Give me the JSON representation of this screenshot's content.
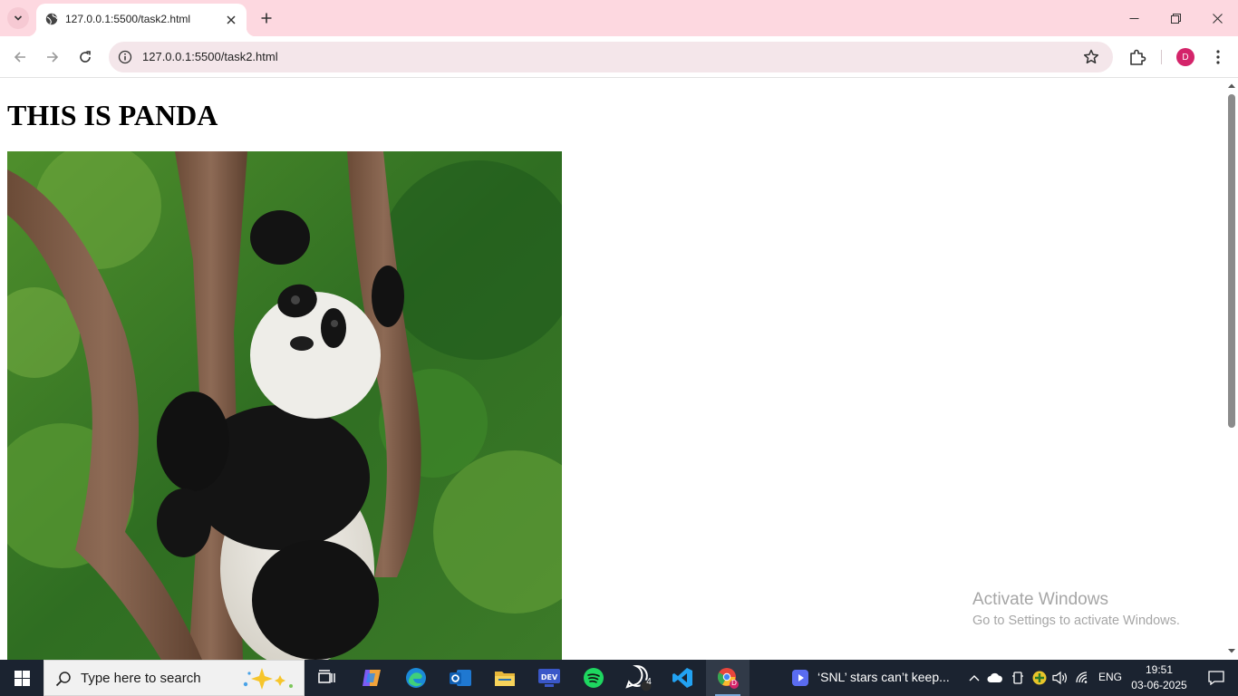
{
  "browser": {
    "tab": {
      "title": "127.0.0.1:5500/task2.html"
    },
    "address_bar": {
      "url": "127.0.0.1:5500/task2.html"
    },
    "profile_initial": "D"
  },
  "page": {
    "heading": "THIS IS PANDA"
  },
  "watermark": {
    "title": "Activate Windows",
    "subtitle": "Go to Settings to activate Windows."
  },
  "taskbar": {
    "search_placeholder": "Type here to search",
    "whatsapp_badge": "4",
    "chrome_badge": "D",
    "news_text": "‘SNL’ stars can’t keep...",
    "language": "ENG",
    "time": "19:51",
    "date": "03-06-2025"
  }
}
